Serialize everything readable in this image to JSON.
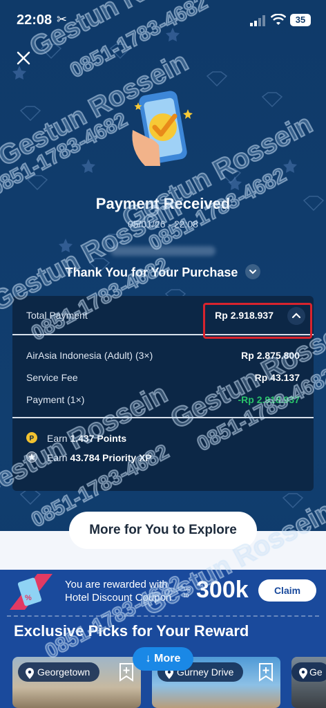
{
  "status_bar": {
    "time": "22:08",
    "battery": "35"
  },
  "header": {
    "title": "Payment Received",
    "datetime": "05/01/26 - 22:08"
  },
  "section": {
    "thanks_label": "Thank You for Your Purchase"
  },
  "payment": {
    "total_label": "Total Payment",
    "total_value": "Rp 2.918.937",
    "items": [
      {
        "label": "AirAsia Indonesia (Adult) (3×)",
        "value": "Rp 2.875.800"
      },
      {
        "label": "Service Fee",
        "value": "Rp 43.137"
      },
      {
        "label": "Payment (1×)",
        "value": "-Rp 2.918.937"
      }
    ]
  },
  "rewards": {
    "points_prefix": "Earn",
    "points_value": "1.437 Points",
    "xp_prefix": "Earn",
    "xp_value": "43.784 Priority XP"
  },
  "explore_button": "More for You to Explore",
  "coupon": {
    "line1": "You are rewarded with",
    "line2": "Hotel Discount Coupon",
    "up_to_1": "up",
    "up_to_2": "to",
    "amount": "300k",
    "claim_label": "Claim"
  },
  "picks": {
    "title": "Exclusive Picks for Your Reward",
    "more_label": "More",
    "tiles": [
      {
        "location": "Georgetown"
      },
      {
        "location": "Gurney Drive"
      },
      {
        "location": "Ge"
      }
    ]
  },
  "watermark": {
    "name": "Gestun Rossein",
    "phone": "0851-1783-4682"
  },
  "colors": {
    "background": "#0f3a69",
    "highlight_border": "#d8242e",
    "payment_green": "#29c36a",
    "accent_blue": "#1a88e6"
  }
}
